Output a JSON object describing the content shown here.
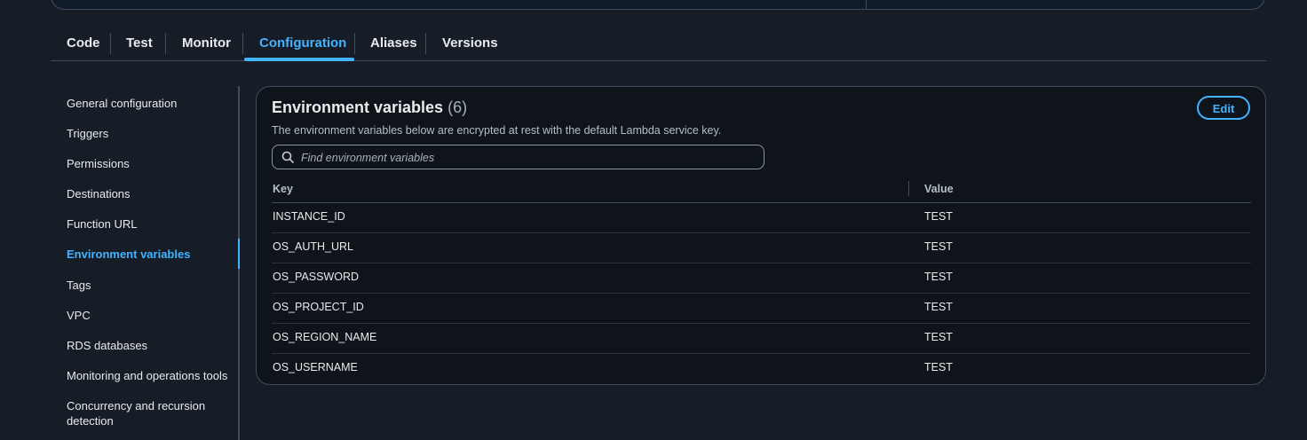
{
  "tabs": [
    {
      "label": "Code"
    },
    {
      "label": "Test"
    },
    {
      "label": "Monitor"
    },
    {
      "label": "Configuration"
    },
    {
      "label": "Aliases"
    },
    {
      "label": "Versions"
    }
  ],
  "active_tab": "Configuration",
  "sidebar": {
    "items": [
      {
        "label": "General configuration"
      },
      {
        "label": "Triggers"
      },
      {
        "label": "Permissions"
      },
      {
        "label": "Destinations"
      },
      {
        "label": "Function URL"
      },
      {
        "label": "Environment variables"
      },
      {
        "label": "Tags"
      },
      {
        "label": "VPC"
      },
      {
        "label": "RDS databases"
      },
      {
        "label": "Monitoring and operations tools"
      },
      {
        "label": "Concurrency and recursion detection"
      }
    ],
    "active": "Environment variables"
  },
  "env": {
    "title": "Environment variables",
    "count": "(6)",
    "description": "The environment variables below are encrypted at rest with the default Lambda service key.",
    "edit_label": "Edit",
    "search_placeholder": "Find environment variables",
    "search_value": "",
    "columns": {
      "key": "Key",
      "value": "Value"
    },
    "rows": [
      {
        "key": "INSTANCE_ID",
        "value": "TEST"
      },
      {
        "key": "OS_AUTH_URL",
        "value": "TEST"
      },
      {
        "key": "OS_PASSWORD",
        "value": "TEST"
      },
      {
        "key": "OS_PROJECT_ID",
        "value": "TEST"
      },
      {
        "key": "OS_REGION_NAME",
        "value": "TEST"
      },
      {
        "key": "OS_USERNAME",
        "value": "TEST"
      }
    ]
  },
  "icons": {
    "search": "search-icon"
  },
  "colors": {
    "accent": "#42b4ff",
    "background": "#161d26",
    "panel": "#0f141a",
    "border": "#414d5c"
  }
}
